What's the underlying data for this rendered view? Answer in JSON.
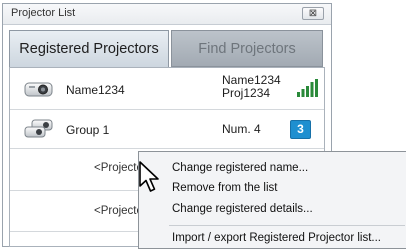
{
  "window": {
    "title": "Projector List",
    "close_glyph": "⊠"
  },
  "tabs": [
    {
      "label": "Registered Projectors",
      "active": true
    },
    {
      "label": "Find Projectors",
      "active": false
    }
  ],
  "list": {
    "rows": [
      {
        "name": "Name1234",
        "info_line1": "Name1234",
        "info_line2": "Proj1234",
        "icon": "projector-icon",
        "status_icon": "signal-strength-icon"
      },
      {
        "name": "Group 1",
        "info_line1": "Num. 4",
        "icon": "projector-group-icon",
        "badge": "3"
      }
    ],
    "placeholders": [
      "<Projector",
      "<Projector"
    ]
  },
  "context_menu": {
    "items": [
      "Change registered name...",
      "Remove from the list",
      "Change registered details...",
      "Import / export Registered Projector list..."
    ]
  },
  "colors": {
    "badge": "#1e8fd0",
    "signal": "#2a8a3a"
  }
}
